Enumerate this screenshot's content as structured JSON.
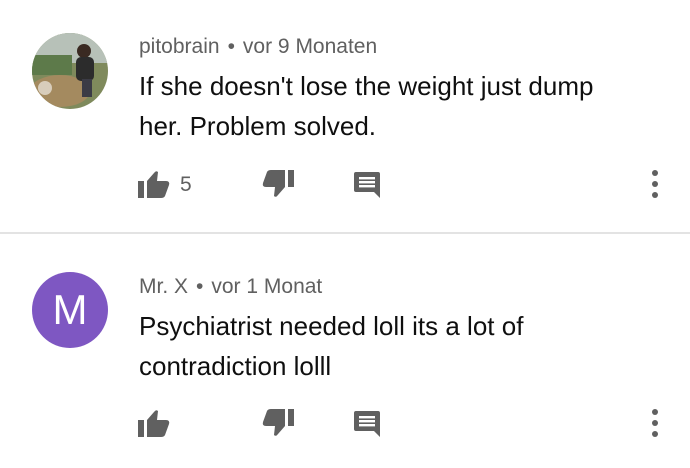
{
  "comments": [
    {
      "author": "pitobrain",
      "separator": "•",
      "time": "vor 9 Monaten",
      "text": "If she doesn't lose the weight just dump her. Problem solved.",
      "avatar_type": "photo",
      "likes": "5"
    },
    {
      "author": "Mr. X",
      "separator": "•",
      "time": "vor 1 Monat",
      "text": "Psychiatrist needed loll its a lot of contradiction lolll",
      "avatar_type": "letter",
      "avatar_letter": "M",
      "avatar_color": "#7e57c2",
      "likes": ""
    }
  ],
  "icons": {
    "like": "thumb-up-icon",
    "dislike": "thumb-down-icon",
    "reply": "comment-icon",
    "more": "more-vertical-icon"
  },
  "colors": {
    "icon": "#606060",
    "meta_text": "#606060",
    "divider": "#e3e3e3"
  }
}
